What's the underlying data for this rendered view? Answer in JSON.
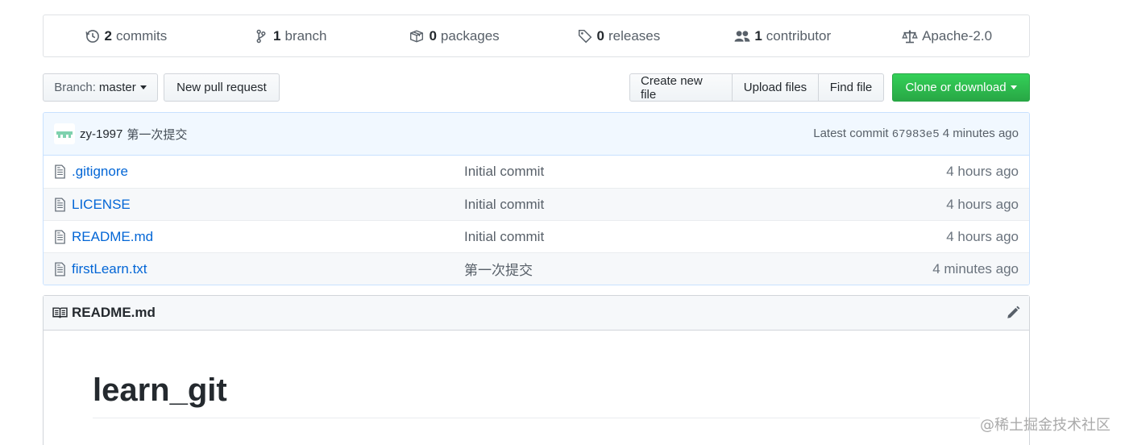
{
  "summary": {
    "commits": {
      "num": "2",
      "label": "commits",
      "icon": "history-icon"
    },
    "branch": {
      "num": "1",
      "label": "branch",
      "icon": "git-branch-icon"
    },
    "packages": {
      "num": "0",
      "label": "packages",
      "icon": "package-icon"
    },
    "releases": {
      "num": "0",
      "label": "releases",
      "icon": "tag-icon"
    },
    "contributor": {
      "num": "1",
      "label": "contributor",
      "icon": "people-icon"
    },
    "license": {
      "label": "Apache-2.0",
      "icon": "law-icon"
    }
  },
  "toolbar": {
    "branch_prefix": "Branch:",
    "branch_value": "master",
    "new_pull_request": "New pull request",
    "create_new_file": "Create new file",
    "upload_files": "Upload files",
    "find_file": "Find file",
    "clone_or_download": "Clone or download"
  },
  "commit": {
    "author": "zy-1997",
    "message": "第一次提交",
    "latest_label": "Latest commit",
    "sha": "67983e5",
    "age": "4 minutes ago"
  },
  "files": [
    {
      "name": ".gitignore",
      "message": "Initial commit",
      "age": "4 hours ago"
    },
    {
      "name": "LICENSE",
      "message": "Initial commit",
      "age": "4 hours ago"
    },
    {
      "name": "README.md",
      "message": "Initial commit",
      "age": "4 hours ago"
    },
    {
      "name": "firstLearn.txt",
      "message": "第一次提交",
      "age": "4 minutes ago"
    }
  ],
  "readme": {
    "title": "README.md",
    "heading": "learn_git"
  },
  "watermark": "@稀土掘金技术社区",
  "colors": {
    "link": "#0366d6",
    "green": "#28a745",
    "commit_bg": "#f1f8ff"
  }
}
